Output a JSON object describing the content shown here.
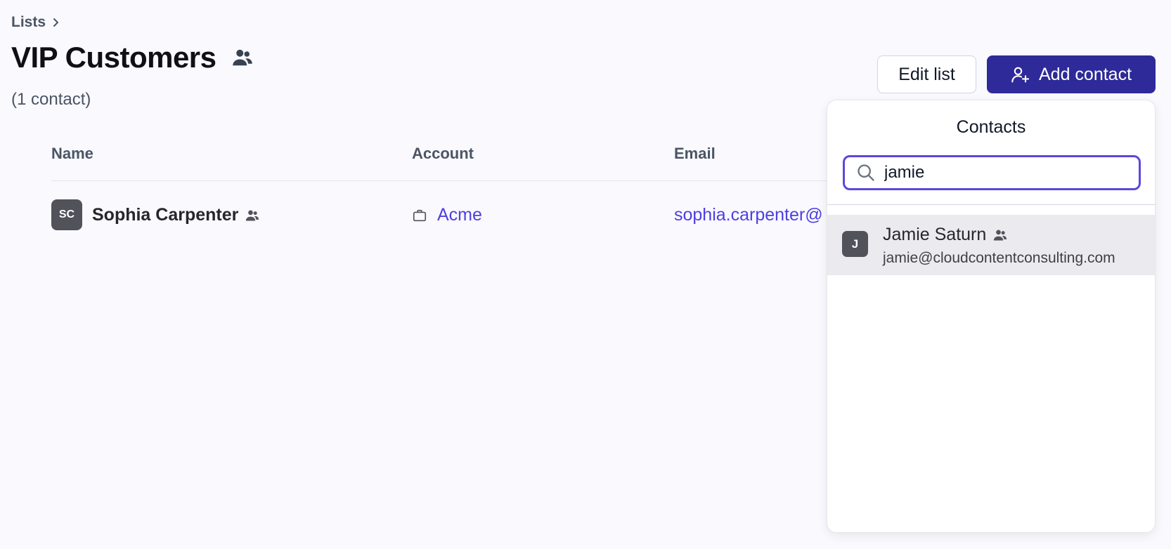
{
  "breadcrumb": {
    "label": "Lists"
  },
  "header": {
    "title": "VIP Customers",
    "subtitle": "(1 contact)",
    "title_icon": "users-icon"
  },
  "toolbar": {
    "edit_label": "Edit list",
    "add_label": "Add contact",
    "add_icon": "user-plus-icon"
  },
  "table": {
    "columns": [
      "Name",
      "Account",
      "Email"
    ],
    "rows": [
      {
        "initials": "SC",
        "name": "Sophia Carpenter",
        "account": "Acme",
        "email": "sophia.carpenter@"
      }
    ]
  },
  "popover": {
    "title": "Contacts",
    "search_value": "jamie",
    "results": [
      {
        "initial": "J",
        "name": "Jamie Saturn",
        "email": "jamie@cloudcontentconsulting.com"
      }
    ]
  },
  "colors": {
    "accent": "#2e2a99",
    "link": "#4f3fe0",
    "focus_ring": "#5b47e0",
    "background": "#f9f9fe"
  }
}
